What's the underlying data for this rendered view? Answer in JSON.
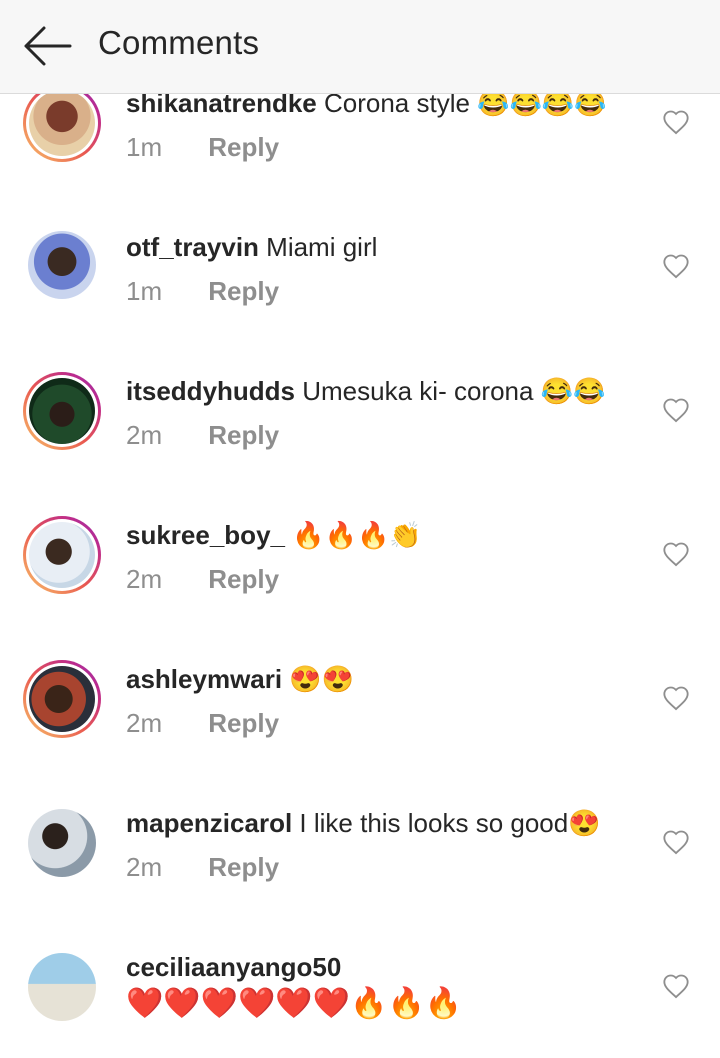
{
  "header": {
    "title": "Comments",
    "back_icon": "arrow-left-icon"
  },
  "comments": [
    {
      "username": "shikanatrendke",
      "text": "Corona style 😂😂😂😂",
      "time": "1m",
      "reply": "Reply"
    },
    {
      "username": "otf_trayvin",
      "text": "Miami girl",
      "time": "1m",
      "reply": "Reply"
    },
    {
      "username": "itseddyhudds",
      "text": "Umesuka ki- corona 😂😂",
      "time": "2m",
      "reply": "Reply"
    },
    {
      "username": "sukree_boy_",
      "text": "🔥🔥🔥👏",
      "time": "2m",
      "reply": "Reply"
    },
    {
      "username": "ashleymwari",
      "text": "😍😍",
      "time": "2m",
      "reply": "Reply"
    },
    {
      "username": "mapenzicarol",
      "text": "I like this looks so good😍",
      "time": "2m",
      "reply": "Reply"
    },
    {
      "username": "ceciliaanyango50",
      "text": "❤️❤️❤️❤️❤️❤️🔥🔥🔥",
      "time": "",
      "reply": ""
    }
  ],
  "colors": {
    "text": "#262626",
    "muted": "#8e8e8e",
    "header_bg": "#f7f7f7",
    "divider": "#dbdbdb"
  }
}
